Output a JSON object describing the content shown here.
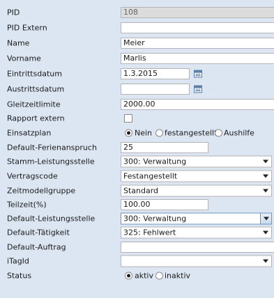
{
  "form": {
    "pid": {
      "label": "PID",
      "value": "108"
    },
    "pid_extern": {
      "label": "PID Extern",
      "value": ""
    },
    "name": {
      "label": "Name",
      "value": "Meier"
    },
    "vorname": {
      "label": "Vorname",
      "value": "Marlis"
    },
    "eintrittsdatum": {
      "label": "Eintrittsdatum",
      "value": "1.3.2015"
    },
    "austrittsdatum": {
      "label": "Austrittsdatum",
      "value": ""
    },
    "gleitzeitlimite": {
      "label": "Gleitzeitlimite",
      "value": "2000.00"
    },
    "rapport_extern": {
      "label": "Rapport extern",
      "checked": false
    },
    "einsatzplan": {
      "label": "Einsatzplan",
      "options": [
        "Nein",
        "festangestellt",
        "Aushilfe"
      ],
      "selected": "Nein"
    },
    "default_ferienanspruch": {
      "label": "Default-Ferienanspruch",
      "value": "25"
    },
    "stamm_leistungsstelle": {
      "label": "Stamm-Leistungsstelle",
      "value": "300: Verwaltung"
    },
    "vertragscode": {
      "label": "Vertragscode",
      "value": "Festangestellt"
    },
    "zeitmodellgruppe": {
      "label": "Zeitmodellgruppe",
      "value": "Standard"
    },
    "teilzeit": {
      "label": "Teilzeit(%)",
      "value": "100.00"
    },
    "default_leistungsstelle": {
      "label": "Default-Leistungsstelle",
      "value": "300: Verwaltung"
    },
    "default_taetigkeit": {
      "label": "Default-Tätigkeit",
      "value": "325: Fehlwert"
    },
    "default_auftrag": {
      "label": "Default-Auftrag",
      "value": ""
    },
    "itagid": {
      "label": "iTagId",
      "value": ""
    },
    "status": {
      "label": "Status",
      "options": [
        "aktiv",
        "inaktiv"
      ],
      "selected": "aktiv"
    }
  },
  "icons": {
    "calendar": "calendar-icon"
  }
}
